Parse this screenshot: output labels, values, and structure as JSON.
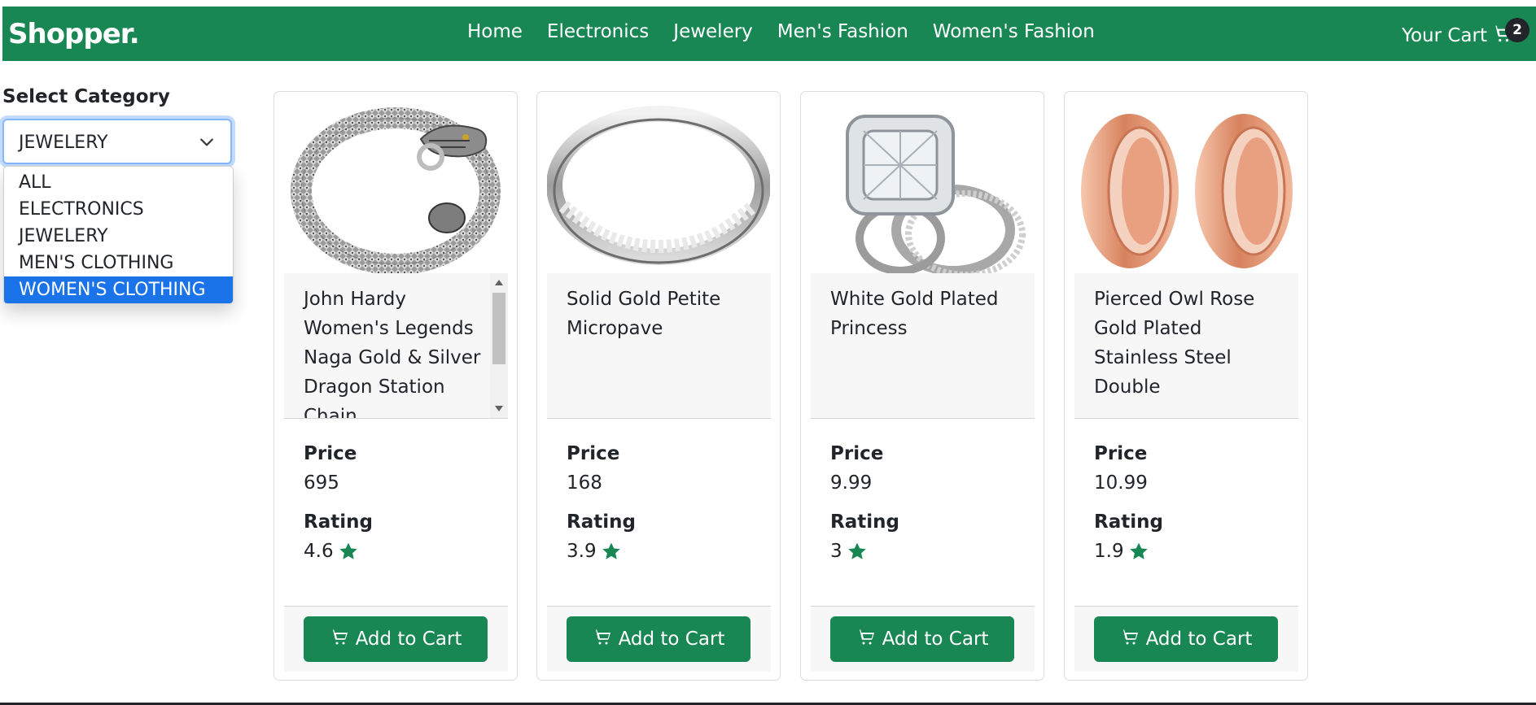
{
  "navbar": {
    "brand": "Shopper.",
    "links": [
      "Home",
      "Electronics",
      "Jewelery",
      "Men's Fashion",
      "Women's Fashion"
    ],
    "cart_label": "Your Cart",
    "cart_count": "2",
    "bg_color": "#198754"
  },
  "sidebar": {
    "label": "Select Category",
    "selected": "JEWELERY",
    "options": [
      "ALL",
      "ELECTRONICS",
      "JEWELERY",
      "MEN'S CLOTHING",
      "WOMEN'S CLOTHING"
    ],
    "highlighted_option": "WOMEN'S CLOTHING"
  },
  "labels": {
    "price": "Price",
    "rating": "Rating",
    "add_to_cart": "Add to Cart"
  },
  "products": [
    {
      "title": "John Hardy Women's Legends Naga Gold & Silver Dragon Station Chain",
      "price": "695",
      "rating": "4.6",
      "image_icon": "dragon-bracelet"
    },
    {
      "title": "Solid Gold Petite Micropave",
      "price": "168",
      "rating": "3.9",
      "image_icon": "pave-ring"
    },
    {
      "title": "White Gold Plated Princess",
      "price": "9.99",
      "rating": "3",
      "image_icon": "princess-ring-set"
    },
    {
      "title": "Pierced Owl Rose Gold Plated Stainless Steel Double",
      "price": "10.99",
      "rating": "1.9",
      "image_icon": "rose-gold-tunnels"
    }
  ]
}
